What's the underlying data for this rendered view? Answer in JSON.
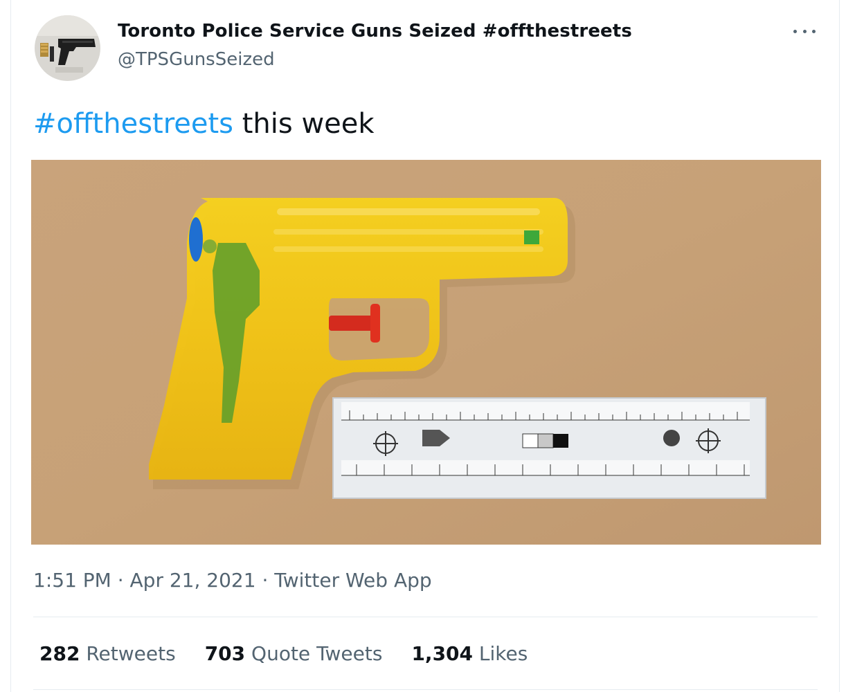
{
  "author": {
    "name": "Toronto Police Service Guns Seized #offthestreets",
    "handle": "@TPSGunsSeized"
  },
  "tweet": {
    "hashtag": "#offthestreets",
    "text": " this week"
  },
  "meta": {
    "time": "1:51 PM",
    "sep1": " · ",
    "date": "Apr 21, 2021",
    "sep2": " · ",
    "source": "Twitter Web App"
  },
  "stats": {
    "retweets_count": "282",
    "retweets_label": " Retweets",
    "quotes_count": "703",
    "quotes_label": " Quote Tweets",
    "likes_count": "1,304",
    "likes_label": " Likes"
  },
  "icons": {
    "more": "more-horizontal-icon"
  },
  "colors": {
    "link": "#1d9bf0",
    "secondary": "#536471",
    "text": "#0f1419",
    "border": "#e6ecf0"
  }
}
